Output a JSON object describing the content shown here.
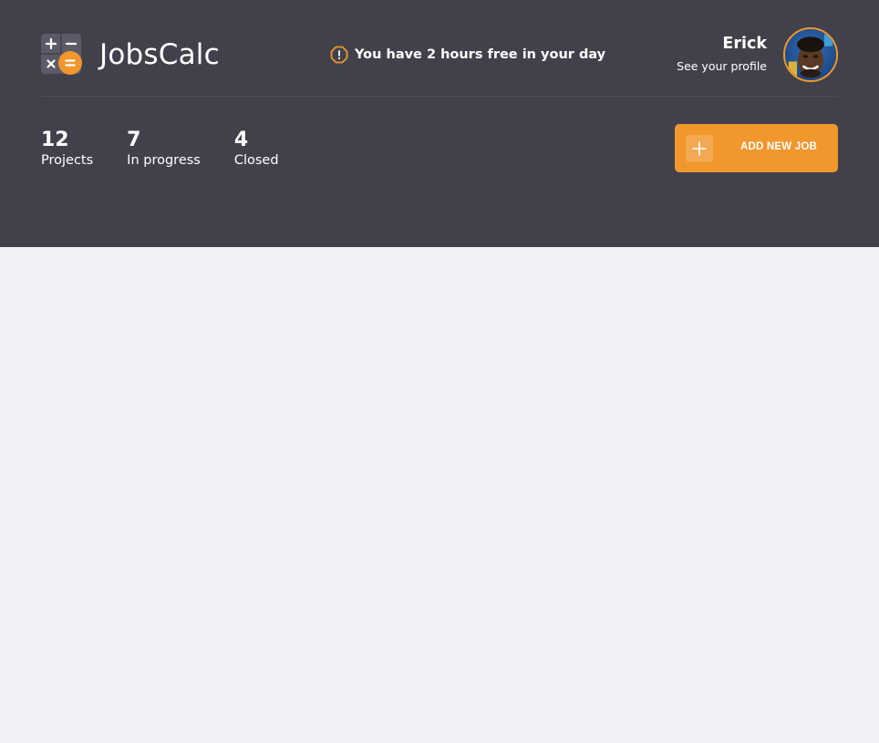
{
  "header": {
    "app_name": "JobsCalc",
    "notice": "You have 2 hours free in your day",
    "profile": {
      "name": "Erick",
      "link_label": "See your profile"
    },
    "stats": [
      {
        "value": "12",
        "label": "Projects"
      },
      {
        "value": "7",
        "label": "In progress"
      },
      {
        "value": "4",
        "label": "Closed"
      }
    ],
    "add_button_label": "ADD NEW JOB"
  },
  "icons": {
    "logo": "calculator-logo-icon",
    "notice": "alert-octagon-icon",
    "add": "plus-icon"
  },
  "colors": {
    "header_bg": "#41414C",
    "accent": "#F1972C",
    "page_bg": "#F0F2F5",
    "text_light": "#FFFFFF"
  }
}
